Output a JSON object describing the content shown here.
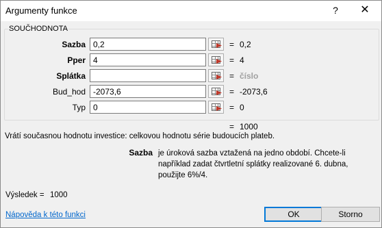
{
  "window": {
    "title": "Argumenty funkce",
    "help_glyph": "?",
    "close_glyph": "✕"
  },
  "function_group": {
    "name": "SOUČHODNOTA",
    "args": [
      {
        "label": "Sazba",
        "bold": true,
        "value": "0,2",
        "result": "0,2",
        "eq": "="
      },
      {
        "label": "Pper",
        "bold": true,
        "value": "4",
        "result": "4",
        "eq": "="
      },
      {
        "label": "Splátka",
        "bold": true,
        "value": "",
        "result": "číslo",
        "eq": "="
      },
      {
        "label": "Bud_hod",
        "bold": false,
        "value": "-2073,6",
        "result": "-2073,6",
        "eq": "="
      },
      {
        "label": "Typ",
        "bold": false,
        "value": "0",
        "result": "0",
        "eq": "="
      }
    ],
    "total_eq": "=",
    "total_result": "1000"
  },
  "description": "Vrátí současnou hodnotu investice: celkovou hodnotu série budoucích plateb.",
  "argument_help": {
    "name": "Sazba",
    "text": "je úroková sazba vztažená na jedno období. Chcete-li například zadat čtvrtletní splátky realizované 6. dubna, použijte 6%/4."
  },
  "footer": {
    "vysledek_label": "Výsledek =",
    "vysledek_value": "1000",
    "help_link": "Nápověda k této funkci",
    "ok_label": "OK",
    "cancel_label": "Storno"
  }
}
